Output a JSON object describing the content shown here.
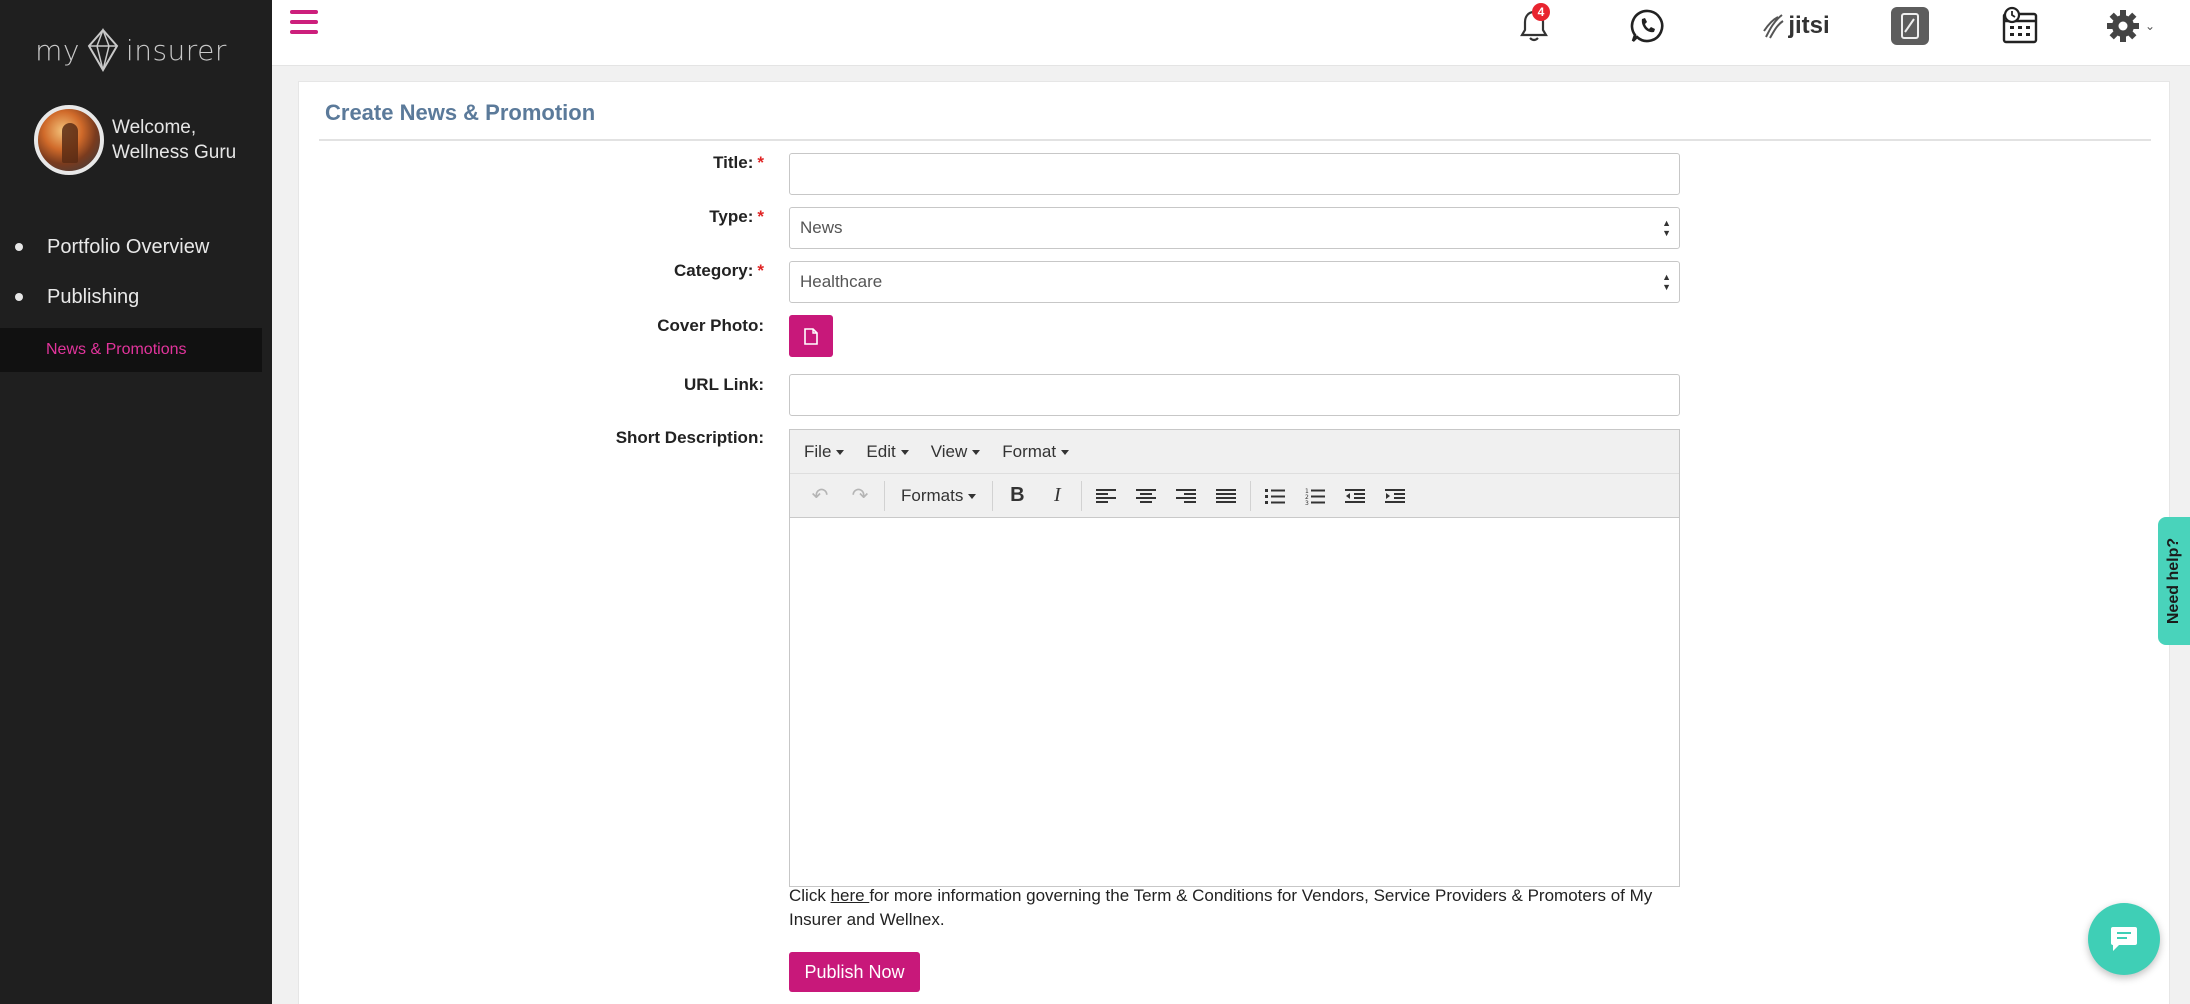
{
  "sidebar": {
    "logo_left": "my",
    "logo_right": "insurer",
    "welcome_line1": "Welcome,",
    "welcome_line2": "Wellness Guru",
    "items": [
      {
        "label": "Portfolio Overview"
      },
      {
        "label": "Publishing"
      }
    ],
    "sub_item": "News & Promotions"
  },
  "header": {
    "notification_count": "4",
    "jitsi_label": "jitsi"
  },
  "form": {
    "title": "Create News & Promotion",
    "labels": {
      "title": "Title:",
      "type": "Type:",
      "category": "Category:",
      "cover_photo": "Cover Photo:",
      "url_link": "URL Link:",
      "short_description": "Short Description:"
    },
    "required_mark": "*",
    "type_value": "News",
    "category_value": "Healthcare",
    "title_value": "",
    "url_value": ""
  },
  "editor": {
    "menus": [
      "File",
      "Edit",
      "View",
      "Format"
    ],
    "formats_label": "Formats",
    "bold": "B",
    "italic": "I"
  },
  "terms": {
    "prefix": "Click ",
    "link": "here ",
    "suffix": "for more information governing the Term & Conditions for Vendors, Service Providers & Promoters of My Insurer and Wellnex."
  },
  "actions": {
    "publish_label": "Publish Now",
    "help_label": "Need help?"
  },
  "colors": {
    "accent": "#c8187a",
    "sidebar_bg": "#1f1f1f",
    "help_teal": "#49d3bb"
  }
}
